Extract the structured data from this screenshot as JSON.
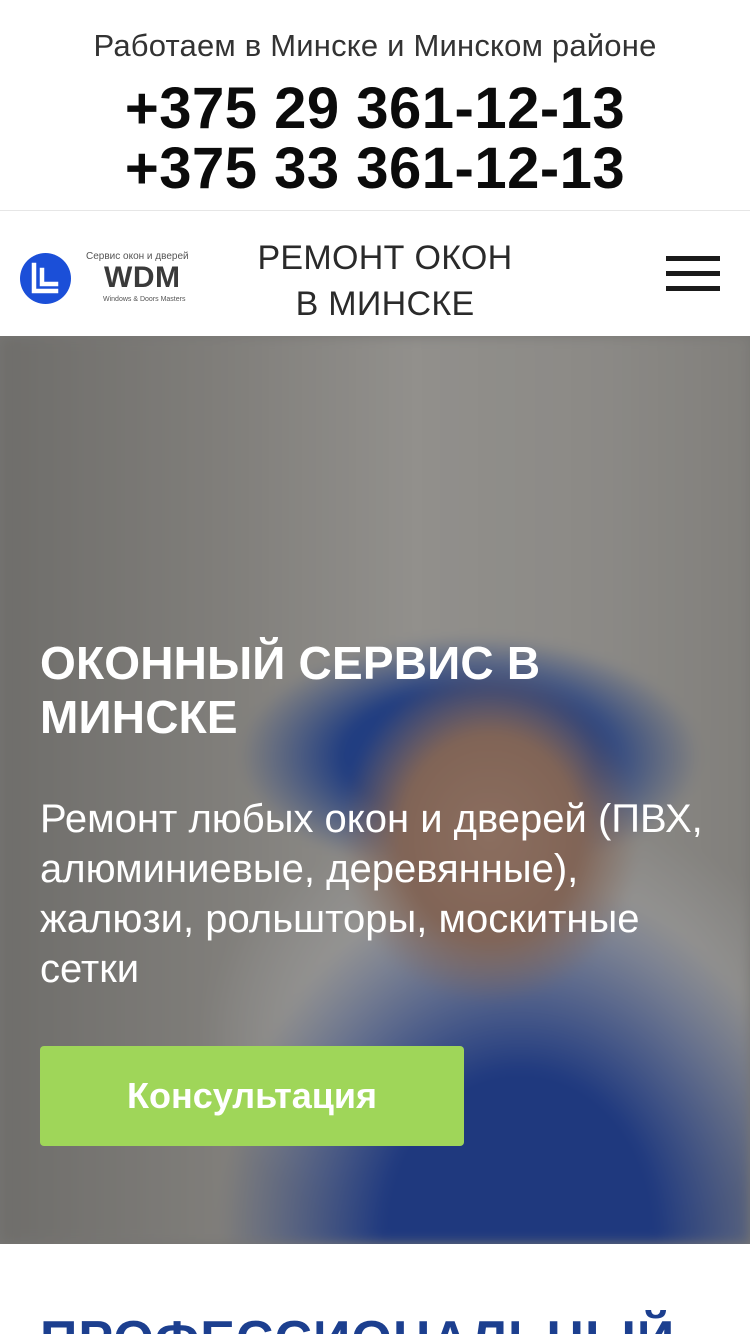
{
  "topbar": {
    "region_text": "Работаем в Минске и Минском районе",
    "phones": [
      "+375 29 361-12-13",
      "+375 33 361-12-13"
    ]
  },
  "header": {
    "logo": {
      "tagline": "Сервис окон и дверей",
      "wordmark": "WDM",
      "subtag": "Windows & Doors Masters",
      "brand_color": "#1b4fd8"
    },
    "title_lines": [
      "РЕМОНТ ОКОН",
      "В МИНСКЕ"
    ],
    "menu_icon": "hamburger-menu-icon"
  },
  "hero": {
    "title": "ОКОННЫЙ СЕРВИС В МИНСКЕ",
    "subtitle": "Ремонт любых окон и дверей (ПВХ, алюминиевые, деревянные), жалюзи, рольшторы, москитные сетки",
    "cta_label": "Консультация",
    "cta_color": "#9fd659"
  },
  "next_section": {
    "heading": "ПРОФЕССИОНАЛЬНЫЙ",
    "heading_color": "#1c3f8f"
  }
}
